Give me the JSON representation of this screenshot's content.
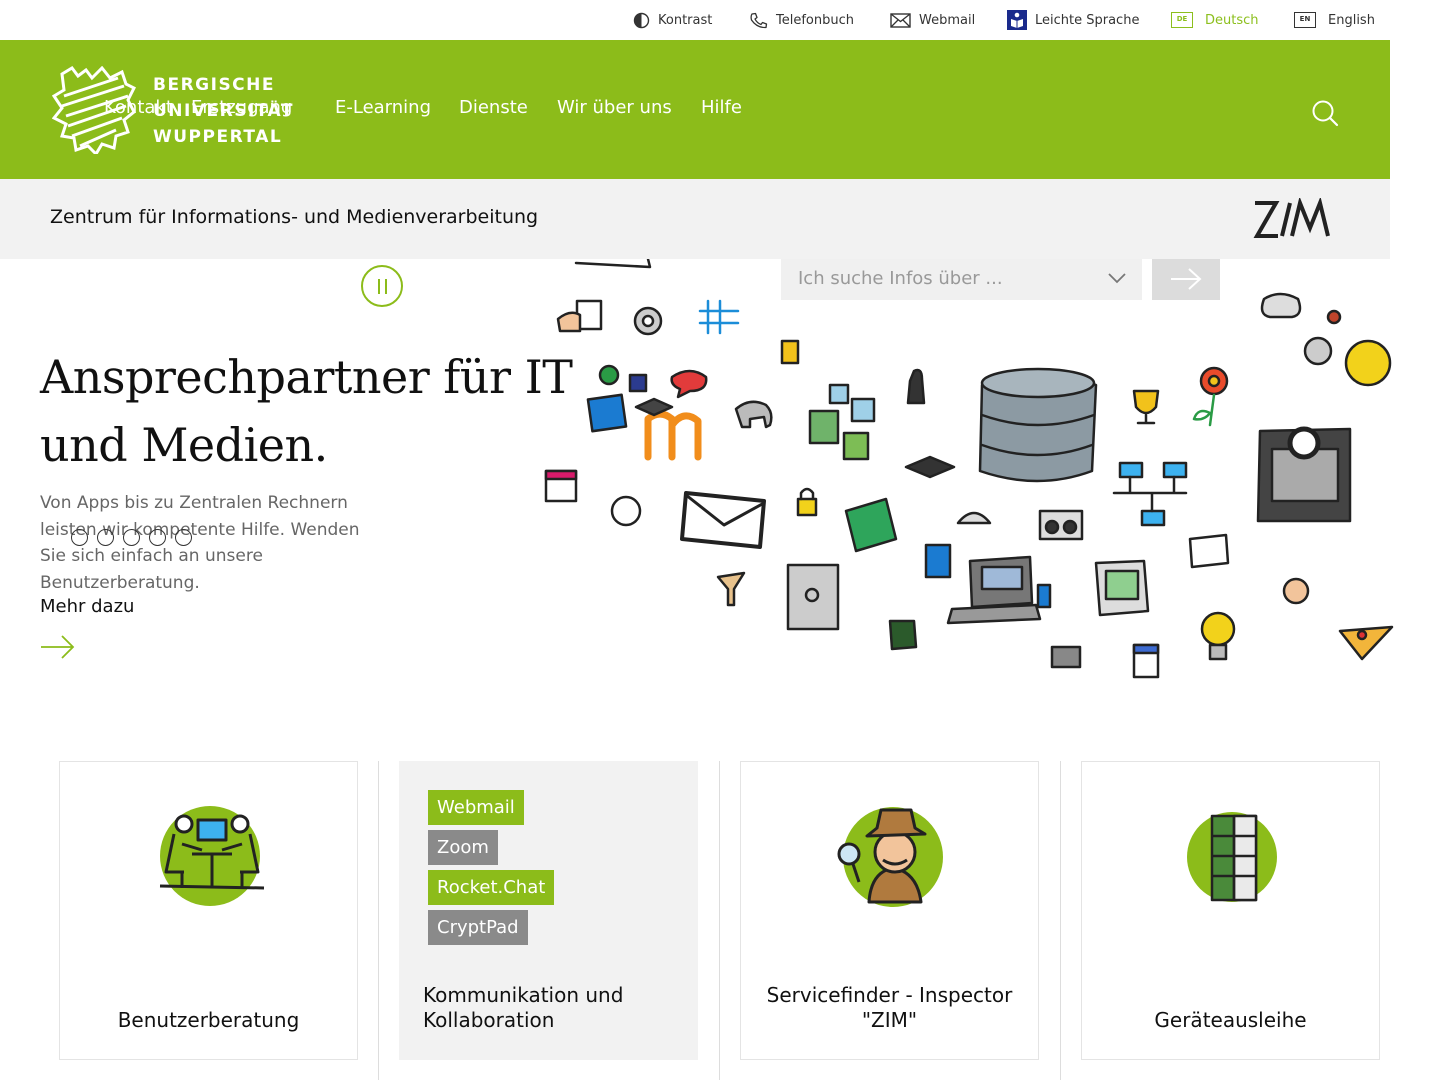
{
  "util_nav": {
    "kontrast": "Kontrast",
    "telefonbuch": "Telefonbuch",
    "webmail": "Webmail",
    "leichte_sprache": "Leichte Sprache",
    "deutsch_badge": "DE",
    "deutsch": "Deutsch",
    "english_badge": "EN",
    "english": "English"
  },
  "logo": {
    "line1": "BERGISCHE",
    "line2": "UNIVERSITÄT",
    "line3": "WUPPERTAL"
  },
  "main_nav": [
    "Kontakt",
    "Erstzugang",
    "E-Learning",
    "Dienste",
    "Wir über uns",
    "Hilfe"
  ],
  "subheader": {
    "title": "Zentrum für Informations- und Medienverarbeitung"
  },
  "hero": {
    "title": "Ansprechpartner für IT und Medien.",
    "text": "Von Apps bis zu Zentralen Rechnern leisten wir kompetente Hilfe. Wenden Sie sich einfach an unsere Benutzerberatung.",
    "more": "Mehr dazu",
    "slides": 5
  },
  "search": {
    "placeholder": "Ich suche Infos über ..."
  },
  "cards": [
    {
      "title": "Benutzerberatung"
    },
    {
      "title": "Kommunikation und Kollaboration",
      "tags": [
        "Webmail",
        "Zoom",
        "Rocket.Chat",
        "CryptPad"
      ]
    },
    {
      "title": "Servicefinder - Inspector \"ZIM\""
    },
    {
      "title": "Geräteausleihe"
    }
  ],
  "colors": {
    "brand_green": "#8cbc1a",
    "tag_gray": "#8a8a8a",
    "subheader_bg": "#f2f2f2"
  },
  "icons": [
    "contrast-icon",
    "phone-icon",
    "mail-icon",
    "easy-language-icon",
    "language-de-icon",
    "language-en-icon",
    "search-icon",
    "arrow-right-icon",
    "chevron-down-icon",
    "pause-icon"
  ]
}
